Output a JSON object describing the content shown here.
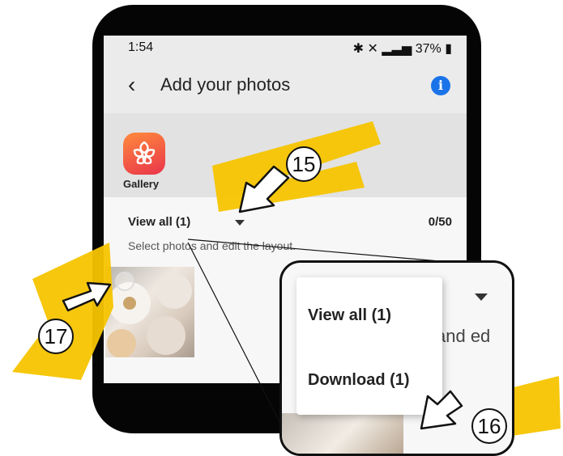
{
  "status": {
    "time": "1:54",
    "icons_text": "37%"
  },
  "appbar": {
    "back_icon": "back-arrow-icon",
    "title": "Add your photos",
    "info_icon": "info-icon"
  },
  "source": {
    "gallery_label": "Gallery"
  },
  "filter": {
    "view_all": "View all (1)",
    "count": "0/50"
  },
  "hint": "Select photos and edit the layout.",
  "menu": {
    "items": [
      "View all (1)",
      "Download (1)"
    ],
    "partial_text": "and ed"
  },
  "markers": [
    "15",
    "16",
    "17"
  ],
  "colors": {
    "highlighter": "#f5c400",
    "info_blue": "#1a73e8",
    "gallery_orange": "#ff8b3d"
  }
}
